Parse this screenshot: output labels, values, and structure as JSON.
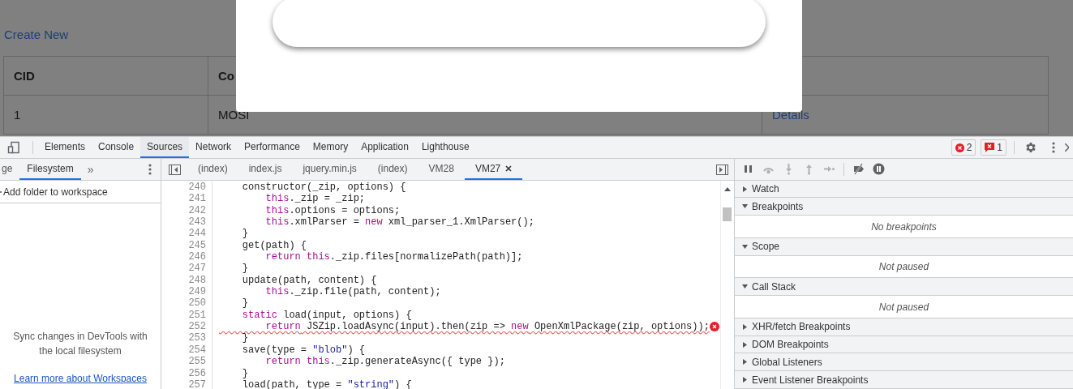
{
  "page": {
    "link": "Create New",
    "columns": [
      "CID",
      "Co"
    ],
    "rows": [
      {
        "cells": [
          "1",
          "MOSI"
        ],
        "action": "Details"
      }
    ]
  },
  "devtools": {
    "tabs": [
      {
        "label": "Elements",
        "selected": false
      },
      {
        "label": "Console",
        "selected": false
      },
      {
        "label": "Sources",
        "selected": true
      },
      {
        "label": "Network",
        "selected": false
      },
      {
        "label": "Performance",
        "selected": false
      },
      {
        "label": "Memory",
        "selected": false
      },
      {
        "label": "Application",
        "selected": false
      },
      {
        "label": "Lighthouse",
        "selected": false
      }
    ],
    "badges": {
      "errors": "2",
      "issues": "1"
    },
    "navigator": {
      "tabs": [
        {
          "label": "ge",
          "selected": false
        },
        {
          "label": "Filesystem",
          "selected": true
        }
      ],
      "more": "»",
      "action": "Add folder to workspace",
      "message": "Sync changes in DevTools with the local filesystem",
      "link": "Learn more about Workspaces"
    },
    "editor": {
      "tabs": [
        {
          "label": "(index)",
          "selected": false,
          "closable": false
        },
        {
          "label": "index.js",
          "selected": false,
          "closable": false
        },
        {
          "label": "jquery.min.js",
          "selected": false,
          "closable": false
        },
        {
          "label": "(index)",
          "selected": false,
          "closable": false
        },
        {
          "label": "VM28",
          "selected": false,
          "closable": false
        },
        {
          "label": "VM27",
          "selected": true,
          "closable": true
        }
      ],
      "lines": [
        {
          "number": "240",
          "error": false,
          "tokens": [
            {
              "kind": "plain",
              "text": "    constructor(_zip, options) {"
            }
          ]
        },
        {
          "number": "241",
          "error": false,
          "tokens": [
            {
              "kind": "keyword",
              "text": "        this"
            },
            {
              "kind": "plain",
              "text": "._zip = _zip;"
            }
          ]
        },
        {
          "number": "242",
          "error": false,
          "tokens": [
            {
              "kind": "keyword",
              "text": "        this"
            },
            {
              "kind": "plain",
              "text": ".options = options;"
            }
          ]
        },
        {
          "number": "243",
          "error": false,
          "tokens": [
            {
              "kind": "keyword",
              "text": "        this"
            },
            {
              "kind": "plain",
              "text": ".xmlParser = "
            },
            {
              "kind": "keyword",
              "text": "new"
            },
            {
              "kind": "plain",
              "text": " xml_parser_1.XmlParser();"
            }
          ]
        },
        {
          "number": "244",
          "error": false,
          "tokens": [
            {
              "kind": "plain",
              "text": "    }"
            }
          ]
        },
        {
          "number": "245",
          "error": false,
          "tokens": [
            {
              "kind": "plain",
              "text": "    get(path) {"
            }
          ]
        },
        {
          "number": "246",
          "error": false,
          "tokens": [
            {
              "kind": "keyword",
              "text": "        return this"
            },
            {
              "kind": "plain",
              "text": "._zip.files[normalizePath(path)];"
            }
          ]
        },
        {
          "number": "247",
          "error": false,
          "tokens": [
            {
              "kind": "plain",
              "text": "    }"
            }
          ]
        },
        {
          "number": "248",
          "error": false,
          "tokens": [
            {
              "kind": "plain",
              "text": "    update(path, content) {"
            }
          ]
        },
        {
          "number": "249",
          "error": false,
          "tokens": [
            {
              "kind": "keyword",
              "text": "        this"
            },
            {
              "kind": "plain",
              "text": "._zip.file(path, content);"
            }
          ]
        },
        {
          "number": "250",
          "error": false,
          "tokens": [
            {
              "kind": "plain",
              "text": "    }"
            }
          ]
        },
        {
          "number": "251",
          "error": false,
          "tokens": [
            {
              "kind": "keyword",
              "text": "    static"
            },
            {
              "kind": "plain",
              "text": " load(input, options) {"
            }
          ]
        },
        {
          "number": "252",
          "error": true,
          "tokens": [
            {
              "kind": "keyword",
              "text": "        return"
            },
            {
              "kind": "plain",
              "text": " JSZip.loadAsync(input).then(zip => "
            },
            {
              "kind": "keyword",
              "text": "new"
            },
            {
              "kind": "plain",
              "text": " OpenXmlPackage(zip, options));"
            }
          ]
        },
        {
          "number": "253",
          "error": false,
          "tokens": [
            {
              "kind": "plain",
              "text": "    }"
            }
          ]
        },
        {
          "number": "254",
          "error": false,
          "tokens": [
            {
              "kind": "plain",
              "text": "    save(type = "
            },
            {
              "kind": "string",
              "text": "\"blob\""
            },
            {
              "kind": "plain",
              "text": ") {"
            }
          ]
        },
        {
          "number": "255",
          "error": false,
          "tokens": [
            {
              "kind": "keyword",
              "text": "        return this"
            },
            {
              "kind": "plain",
              "text": "._zip.generateAsync({ type });"
            }
          ]
        },
        {
          "number": "256",
          "error": false,
          "tokens": [
            {
              "kind": "plain",
              "text": "    }"
            }
          ]
        },
        {
          "number": "257",
          "error": false,
          "tokens": [
            {
              "kind": "plain",
              "text": "    load(path, type = "
            },
            {
              "kind": "string",
              "text": "\"string\""
            },
            {
              "kind": "plain",
              "text": ") {"
            }
          ]
        }
      ]
    },
    "debugger": {
      "toolbar": [
        {
          "kind": "pause",
          "disabled": false
        },
        {
          "kind": "step-over",
          "disabled": true
        },
        {
          "kind": "step-into",
          "disabled": true
        },
        {
          "kind": "step-out",
          "disabled": true
        },
        {
          "kind": "step",
          "disabled": true
        },
        {
          "kind": "deactivate",
          "disabled": false
        },
        {
          "kind": "exceptions",
          "disabled": false
        }
      ],
      "sections": [
        {
          "title": "Watch",
          "expanded": false
        },
        {
          "title": "Breakpoints",
          "expanded": true,
          "body": "No breakpoints"
        },
        {
          "title": "Scope",
          "expanded": true,
          "body": "Not paused"
        },
        {
          "title": "Call Stack",
          "expanded": true,
          "body": "Not paused"
        },
        {
          "title": "XHR/fetch Breakpoints",
          "expanded": false
        },
        {
          "title": "DOM Breakpoints",
          "expanded": false
        },
        {
          "title": "Global Listeners",
          "expanded": false
        },
        {
          "title": "Event Listener Breakpoints",
          "expanded": false
        }
      ]
    }
  }
}
